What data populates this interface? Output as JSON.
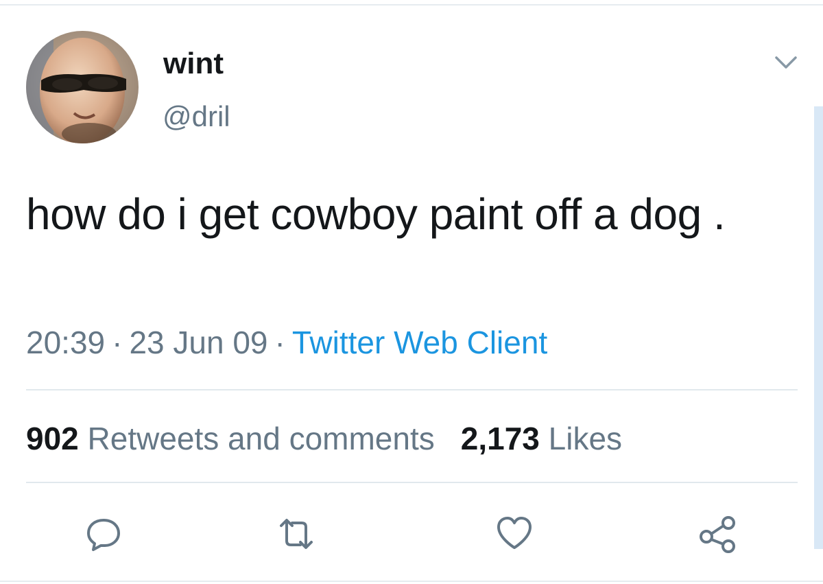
{
  "tweet": {
    "display_name": "wint",
    "handle": "@dril",
    "text": "how do i get cowboy paint off a dog .",
    "time": "20:39",
    "date": "23 Jun 09",
    "separator": "·",
    "source": "Twitter Web Client"
  },
  "stats": {
    "retweets_count": "902",
    "retweets_label": "Retweets and comments",
    "likes_count": "2,173",
    "likes_label": "Likes"
  },
  "colors": {
    "text": "#14171a",
    "secondary": "#657786",
    "link": "#1b95e0",
    "divider": "#e1e8ed"
  },
  "icons": {
    "menu": "chevron-down-icon",
    "reply": "reply-icon",
    "retweet": "retweet-icon",
    "like": "heart-icon",
    "share": "share-icon"
  }
}
